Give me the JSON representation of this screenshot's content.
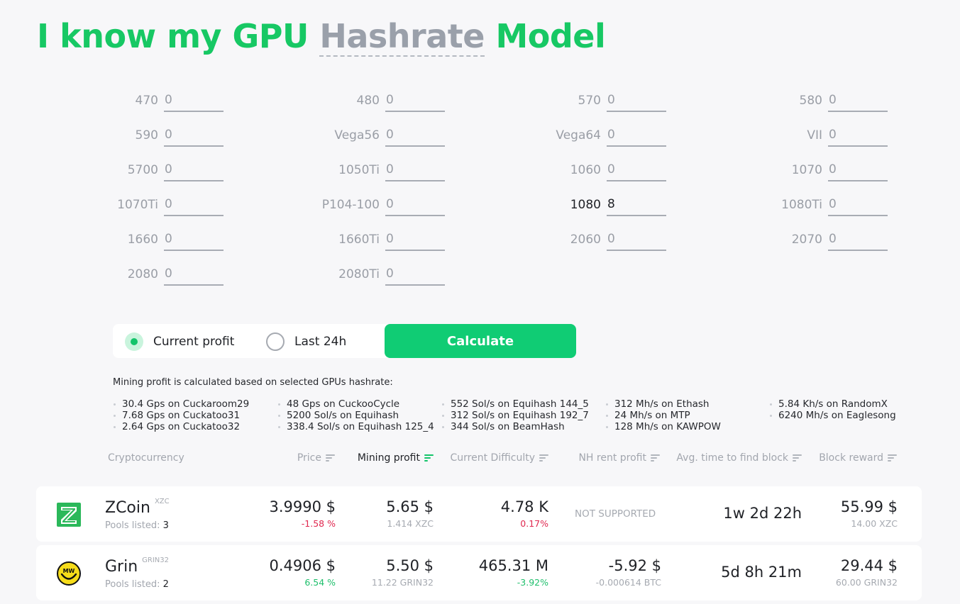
{
  "title": {
    "prefix": "I know my GPU",
    "highlight": "Hashrate",
    "suffix": "Model"
  },
  "gpus": [
    {
      "label": "470",
      "value": "0"
    },
    {
      "label": "480",
      "value": "0"
    },
    {
      "label": "570",
      "value": "0"
    },
    {
      "label": "580",
      "value": "0"
    },
    {
      "label": "590",
      "value": "0"
    },
    {
      "label": "Vega56",
      "value": "0"
    },
    {
      "label": "Vega64",
      "value": "0"
    },
    {
      "label": "VII",
      "value": "0"
    },
    {
      "label": "5700",
      "value": "0"
    },
    {
      "label": "1050Ti",
      "value": "0"
    },
    {
      "label": "1060",
      "value": "0"
    },
    {
      "label": "1070",
      "value": "0"
    },
    {
      "label": "1070Ti",
      "value": "0"
    },
    {
      "label": "P104-100",
      "value": "0"
    },
    {
      "label": "1080",
      "value": "8"
    },
    {
      "label": "1080Ti",
      "value": "0"
    },
    {
      "label": "1660",
      "value": "0"
    },
    {
      "label": "1660Ti",
      "value": "0"
    },
    {
      "label": "2060",
      "value": "0"
    },
    {
      "label": "2070",
      "value": "0"
    },
    {
      "label": "2080",
      "value": "0"
    },
    {
      "label": "2080Ti",
      "value": "0"
    }
  ],
  "mode": {
    "options": [
      {
        "label": "Current profit",
        "selected": true
      },
      {
        "label": "Last 24h",
        "selected": false
      }
    ],
    "calculate_label": "Calculate"
  },
  "hashrate_note": "Mining profit is calculated based on selected GPUs hashrate:",
  "hashrates": [
    [
      "30.4 Gps on Cuckaroom29",
      "7.68 Gps on Cuckatoo31",
      "2.64 Gps on Cuckatoo32"
    ],
    [
      "48 Gps on CuckooCycle",
      "5200 Sol/s on Equihash",
      "338.4 Sol/s on Equihash 125_4"
    ],
    [
      "552 Sol/s on Equihash 144_5",
      "312 Sol/s on Equihash 192_7",
      "344 Sol/s on BeamHash"
    ],
    [
      "312 Mh/s on Ethash",
      "24 Mh/s on MTP",
      "128 Mh/s on KAWPOW"
    ],
    [
      "5.84 Kh/s on RandomX",
      "6240 Mh/s on Eaglesong"
    ]
  ],
  "table": {
    "columns": [
      {
        "label": "Cryptocurrency",
        "sortable": false
      },
      {
        "label": "Price",
        "sortable": true
      },
      {
        "label": "Mining profit",
        "sortable": true,
        "active": true
      },
      {
        "label": "Current Difficulty",
        "sortable": true
      },
      {
        "label": "NH rent profit",
        "sortable": true
      },
      {
        "label": "Avg. time to find block",
        "sortable": true
      },
      {
        "label": "Block reward",
        "sortable": true
      }
    ],
    "pools_label": "Pools listed:",
    "rows": [
      {
        "name": "ZCoin",
        "ticker": "XZC",
        "icon": "zcoin-logo-icon",
        "pools": "3",
        "price": "3.9990 $",
        "price_change": "-1.58 %",
        "profit": "5.65 $",
        "profit_coin": "1.414 XZC",
        "difficulty": "4.78 K",
        "difficulty_change": "0.17%",
        "nh_rent": "NOT SUPPORTED",
        "nh_rent_btc": "",
        "block_time": "1w 2d 22h",
        "reward": "55.99 $",
        "reward_coin": "14.00 XZC"
      },
      {
        "name": "Grin",
        "ticker": "GRIN32",
        "icon": "grin-logo-icon",
        "pools": "2",
        "price": "0.4906 $",
        "price_change": "6.54 %",
        "profit": "5.50 $",
        "profit_coin": "11.22 GRIN32",
        "difficulty": "465.31 M",
        "difficulty_change": "-3.92%",
        "nh_rent": "-5.92 $",
        "nh_rent_btc": "-0.000614 BTC",
        "block_time": "5d 8h 21m",
        "reward": "29.44 $",
        "reward_coin": "60.00 GRIN32"
      }
    ]
  },
  "colors": {
    "brand_green": "#17c864",
    "button_green": "#10cc74",
    "negative": "#e0284f",
    "positive": "#1fbf6c",
    "muted": "#a2a6ae"
  }
}
